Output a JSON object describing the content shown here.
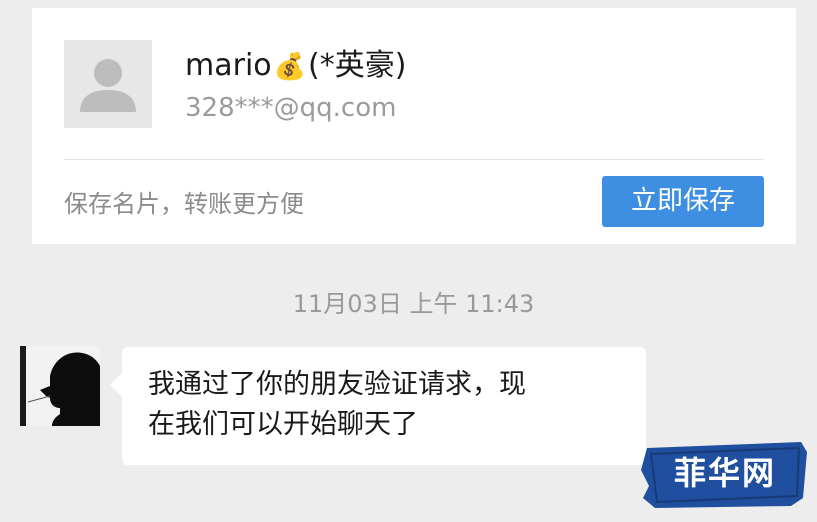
{
  "contact_card": {
    "name": "mario",
    "name_icon": "money-bag-icon",
    "name_icon_glyph": "💰",
    "remark": "(*英豪)",
    "email": "328***@qq.com",
    "save_hint": "保存名片，转账更方便",
    "save_button_label": "立即保存",
    "save_button_color": "#3e8ee2"
  },
  "chat": {
    "timestamp": "11月03日 上午 11:43",
    "messages": [
      {
        "sender": "contact",
        "text_line1": "我通过了你的朋友验证请求，现",
        "text_line2": "在我们可以开始聊天了"
      }
    ]
  },
  "watermark": {
    "text": "菲华网",
    "color": "#1f4f9e"
  }
}
